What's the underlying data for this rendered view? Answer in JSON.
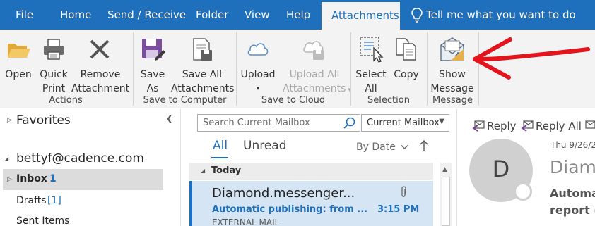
{
  "menu": {
    "items": [
      "File",
      "Home",
      "Send / Receive",
      "Folder",
      "View",
      "Help"
    ],
    "active_tab": "Attachments",
    "tell_me": "Tell me what you want to do"
  },
  "ribbon": {
    "actions": {
      "open": [
        "Open"
      ],
      "quick_print": [
        "Quick",
        "Print"
      ],
      "remove_attachment": [
        "Remove",
        "Attachment"
      ],
      "group": "Actions"
    },
    "save_to_computer": {
      "save_as": [
        "Save",
        "As"
      ],
      "save_all": [
        "Save All",
        "Attachments"
      ],
      "group": "Save to Computer"
    },
    "save_to_cloud": {
      "upload": [
        "Upload"
      ],
      "upload_all": [
        "Upload All",
        "Attachments"
      ],
      "group": "Save to Cloud"
    },
    "selection": {
      "select_all": [
        "Select",
        "All"
      ],
      "copy": [
        "Copy"
      ],
      "group": "Selection"
    },
    "message": {
      "show_message": [
        "Show",
        "Message"
      ],
      "group": "Message"
    }
  },
  "folders": {
    "favorites": "Favorites",
    "account": "bettyf@cadence.com",
    "inbox": "Inbox",
    "inbox_count": "1",
    "drafts": "Drafts",
    "drafts_count": "[1]",
    "sent": "Sent Items"
  },
  "list": {
    "search_placeholder": "Search Current Mailbox",
    "scope": "Current Mailbox",
    "filter_all": "All",
    "filter_unread": "Unread",
    "sort": "By Date",
    "group_header": "Today",
    "message": {
      "sender": "Diamond.messenger...",
      "subject": "Automatic publishing: from ...",
      "time": "3:15 PM",
      "tag": "EXTERNAL MAIL"
    }
  },
  "reading": {
    "reply": "Reply",
    "reply_all": "Reply All",
    "avatar_initial": "D",
    "date": "Thu 9/26/2",
    "title": "Diamo",
    "subject_line1": "Automa",
    "subject_line2": "report ("
  },
  "colors": {
    "brand_blue": "#1e6fbc",
    "annotation_red": "#e3141b"
  },
  "icons": {
    "tell_me": "lightbulb-icon",
    "open": "folder-open-icon",
    "quick_print": "printer-icon",
    "remove_attachment": "x-mark-icon",
    "save_as": "floppy-disk-pencil-icon",
    "save_all": "floppy-stack-icon",
    "upload": "cloud-icon",
    "upload_all": "cloud-stack-icon",
    "select_all": "select-cursor-icon",
    "copy": "copy-pages-icon",
    "show_message": "envelope-arrow-icon",
    "search": "search-icon",
    "attachment": "paperclip-icon",
    "reply": "reply-icon",
    "reply_all": "reply-all-icon"
  }
}
